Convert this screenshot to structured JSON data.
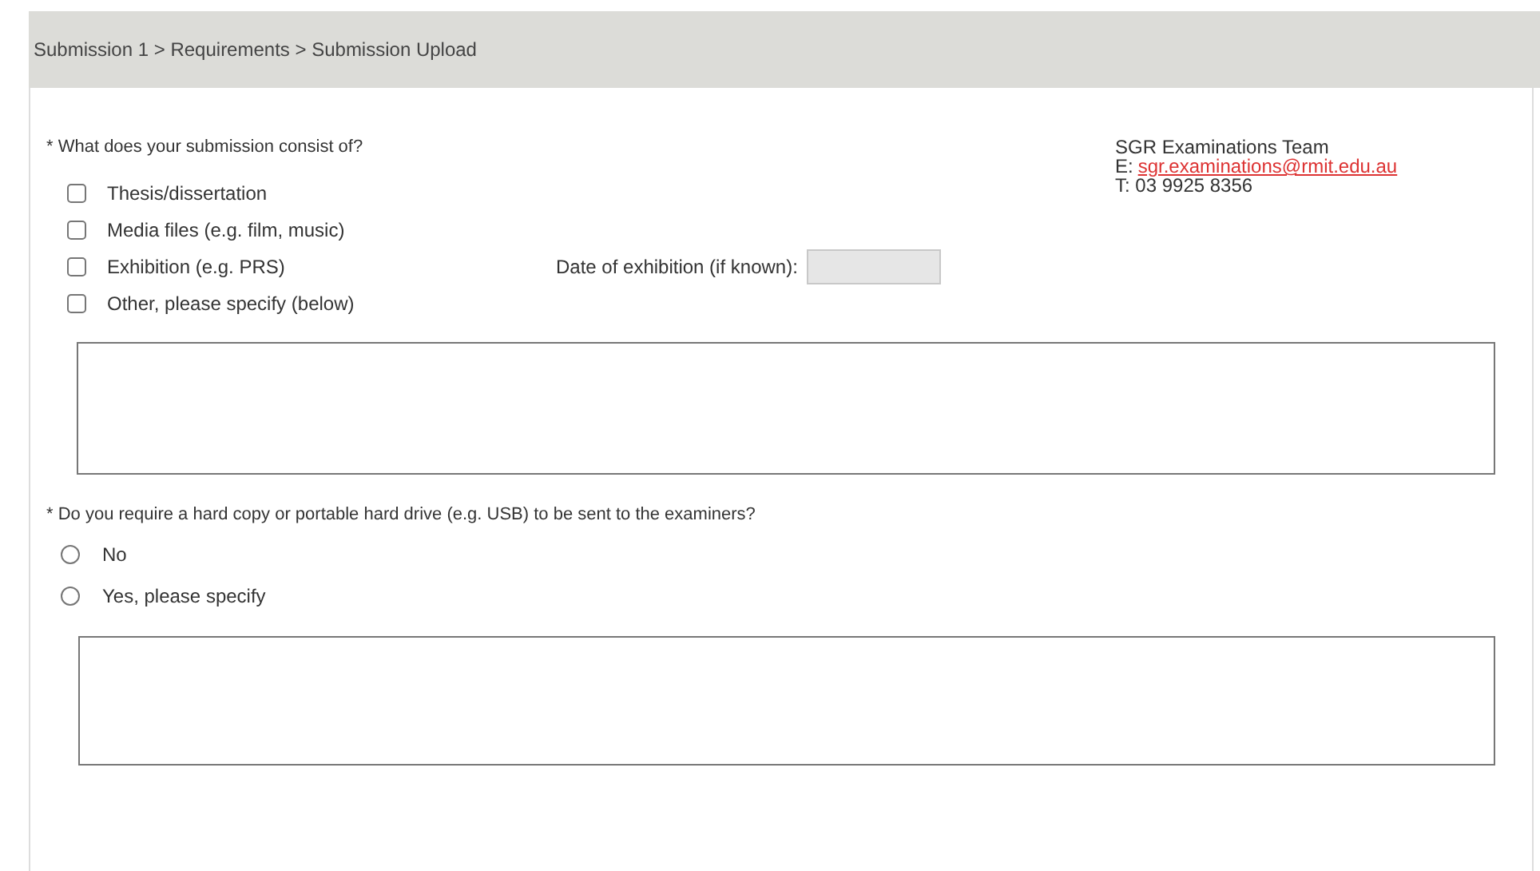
{
  "breadcrumb": "Submission 1 > Requirements > Submission Upload",
  "question_1": {
    "label": "* What does your submission consist of?",
    "options": [
      {
        "label": "Thesis/dissertation",
        "checked": false
      },
      {
        "label": "Media files (e.g. film, music)",
        "checked": false
      },
      {
        "label": "Exhibition (e.g. PRS)",
        "checked": false
      },
      {
        "label": "Other, please specify (below)",
        "checked": false
      }
    ],
    "date_label": "Date of exhibition (if known):"
  },
  "contact": {
    "team": "SGR Examinations Team",
    "email_prefix": "E:",
    "email": "sgr.examinations@rmit.edu.au",
    "phone": "T: 03 9925 8356"
  },
  "question_2": {
    "label": "* Do you require a hard copy or portable hard drive (e.g. USB) to be sent to the examiners?",
    "options": [
      {
        "label": "No",
        "selected": false
      },
      {
        "label": "Yes, please specify",
        "selected": false
      }
    ]
  }
}
